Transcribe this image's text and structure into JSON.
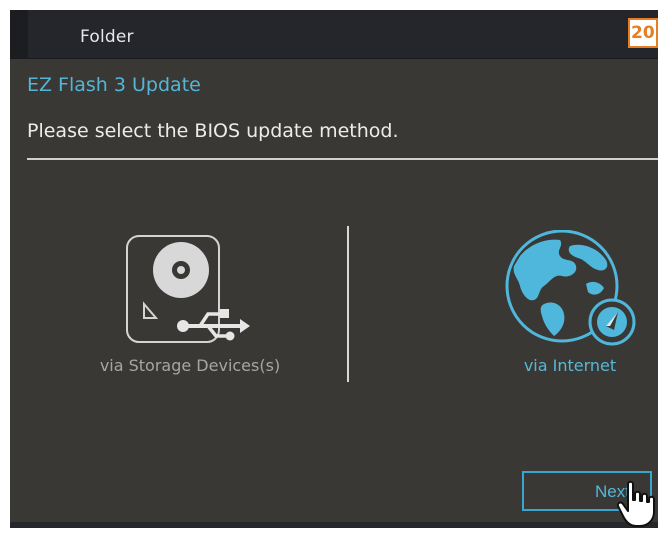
{
  "header": {
    "title": "Folder",
    "page_badge": "20"
  },
  "dialog": {
    "title": "EZ Flash 3 Update",
    "prompt": "Please select the BIOS update method."
  },
  "options": [
    {
      "label": "via Storage Devices(s)",
      "icon": "storage-usb-icon",
      "selected": false
    },
    {
      "label": "via Internet",
      "icon": "globe-internet-icon",
      "selected": true
    }
  ],
  "actions": {
    "next_label": "Next"
  },
  "colors": {
    "background": "#3a3835",
    "topbar": "#24262b",
    "accent": "#53b6d8",
    "badge": "#e67e22"
  },
  "cursor": {
    "icon": "hand-pointer-icon"
  }
}
